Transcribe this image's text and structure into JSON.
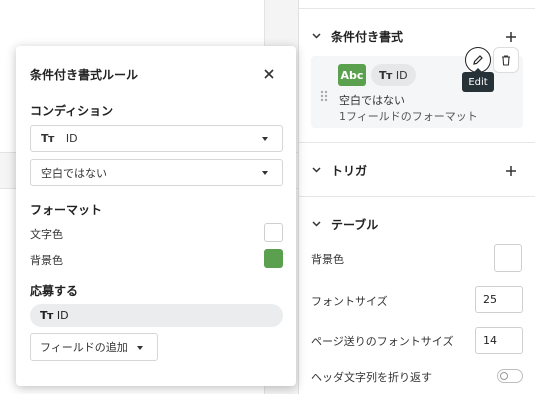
{
  "panel": {
    "conditional": {
      "title": "条件付き書式",
      "rule": {
        "badge": "Abc",
        "field_chip": "ID",
        "condition_text": "空白ではない",
        "summary_text": "1フィールドのフォーマット",
        "edit_tooltip": "Edit"
      }
    },
    "trigger": {
      "title": "トリガ"
    },
    "table": {
      "title": "テーブル",
      "bg_color_label": "背景色",
      "font_size_label": "フォントサイズ",
      "font_size_value": "25",
      "paging_font_size_label": "ページ送りのフォントサイズ",
      "paging_font_size_value": "14",
      "wrap_header_label": "ヘッダ文字列を折り返す",
      "wrap_header_on": false
    }
  },
  "modal": {
    "title": "条件付き書式ルール",
    "condition_heading": "コンディション",
    "field_select_value": "ID",
    "operator_select_value": "空白ではない",
    "format_heading": "フォーマット",
    "text_color_label": "文字色",
    "text_color": "#ffffff",
    "bg_color_label": "背景色",
    "bg_color": "#5ba04e",
    "apply_heading": "応募する",
    "apply_field_chip": "ID",
    "add_field_button": "フィールドの追加"
  },
  "colors": {
    "accent_green": "#5ba04e",
    "tooltip_bg": "#263238"
  }
}
